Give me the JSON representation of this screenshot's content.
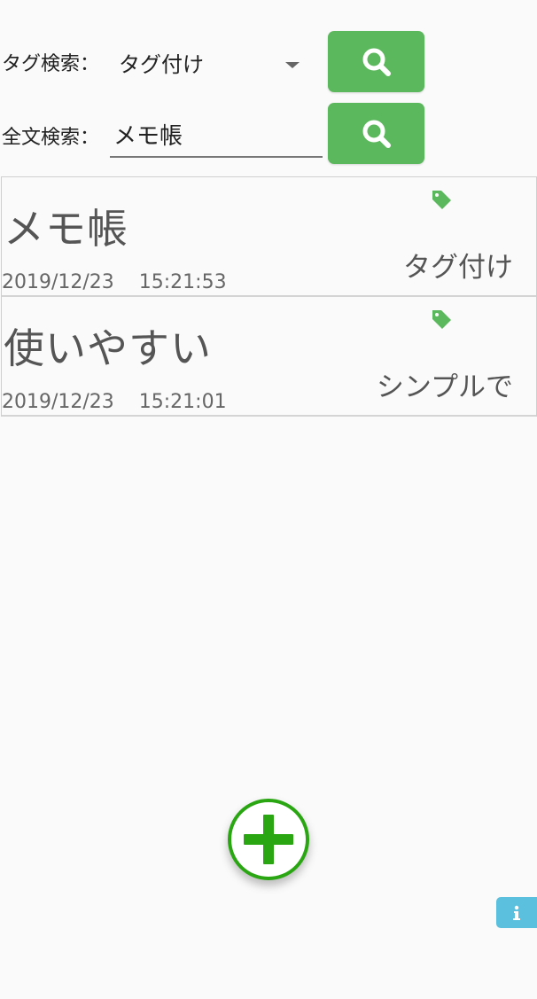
{
  "search": {
    "tag_label": "タグ検索：",
    "tag_selected": "タグ付け",
    "text_label": "全文検索：",
    "text_value": "メモ帳"
  },
  "memos": [
    {
      "title": "メモ帳",
      "date": "2019/12/23    15:21:53",
      "tag": "タグ付け"
    },
    {
      "title": "使いやすい",
      "date": "2019/12/23    15:21:01",
      "tag": "シンプルで"
    }
  ],
  "icons": {
    "search": "search-icon",
    "tag": "tag-icon",
    "add": "plus-icon",
    "info": "info-icon"
  },
  "colors": {
    "accent_green": "#5cb85c",
    "fab_green": "#2aa613",
    "info_blue": "#5bc0de"
  }
}
